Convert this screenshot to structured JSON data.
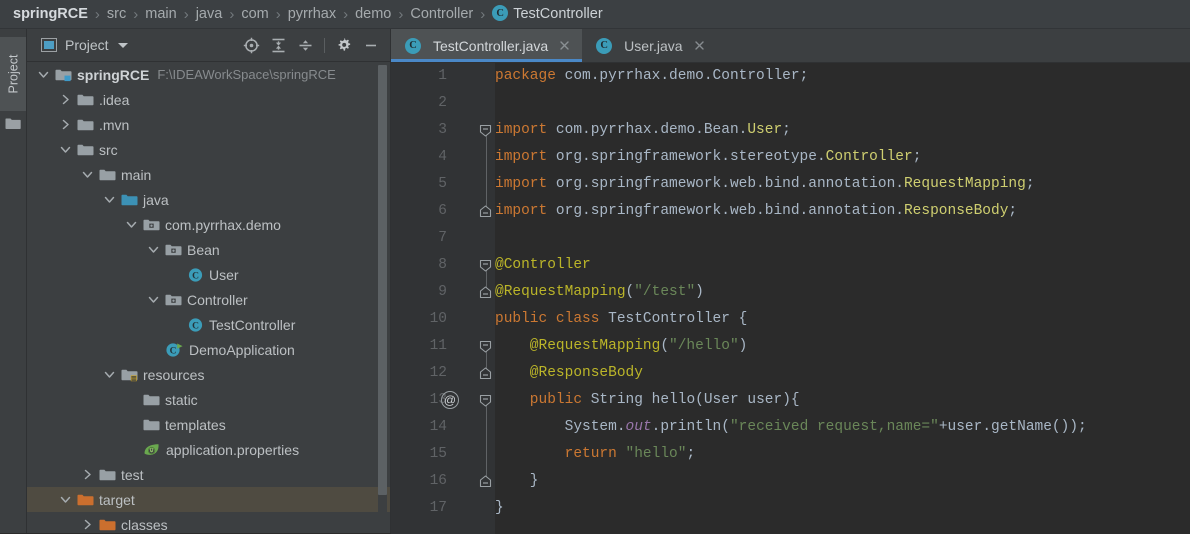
{
  "breadcrumb": {
    "items": [
      {
        "label": "springRCE",
        "type": "root"
      },
      {
        "label": "src",
        "type": "plain"
      },
      {
        "label": "main",
        "type": "plain"
      },
      {
        "label": "java",
        "type": "plain"
      },
      {
        "label": "com",
        "type": "plain"
      },
      {
        "label": "pyrrhax",
        "type": "plain"
      },
      {
        "label": "demo",
        "type": "plain"
      },
      {
        "label": "Controller",
        "type": "plain"
      },
      {
        "label": "TestController",
        "type": "class",
        "badge": "C"
      }
    ],
    "separator": "›"
  },
  "tool_strip": {
    "project_tab_label": "Project",
    "project_tab_icon": "folder-icon"
  },
  "project_panel": {
    "title": "Project",
    "title_icon": "project-window-icon",
    "dropdown_icon": "chevron-down-icon",
    "toolbar": [
      {
        "name": "select-opened-file-icon",
        "tooltip": "Select Opened File"
      },
      {
        "name": "expand-all-icon",
        "tooltip": "Expand All"
      },
      {
        "name": "collapse-all-icon",
        "tooltip": "Collapse All"
      },
      {
        "name": "settings-gear-icon",
        "tooltip": "Settings"
      },
      {
        "name": "hide-panel-icon",
        "tooltip": "Hide"
      }
    ],
    "tree": [
      {
        "label": "springRCE",
        "path": "F:\\IDEAWorkSpace\\springRCE",
        "indent": 0,
        "arrow": "down",
        "icon": "module-folder-icon",
        "bold": true,
        "selected": false
      },
      {
        "label": ".idea",
        "path": "",
        "indent": 1,
        "arrow": "right",
        "icon": "folder-icon",
        "bold": false,
        "selected": false
      },
      {
        "label": ".mvn",
        "path": "",
        "indent": 1,
        "arrow": "right",
        "icon": "folder-icon",
        "bold": false,
        "selected": false
      },
      {
        "label": "src",
        "path": "",
        "indent": 1,
        "arrow": "down",
        "icon": "folder-icon",
        "bold": false,
        "selected": false
      },
      {
        "label": "main",
        "path": "",
        "indent": 2,
        "arrow": "down",
        "icon": "folder-icon",
        "bold": false,
        "selected": false
      },
      {
        "label": "java",
        "path": "",
        "indent": 3,
        "arrow": "down",
        "icon": "source-root-folder-icon",
        "bold": false,
        "selected": false
      },
      {
        "label": "com.pyrrhax.demo",
        "path": "",
        "indent": 4,
        "arrow": "down",
        "icon": "package-icon",
        "bold": false,
        "selected": false
      },
      {
        "label": "Bean",
        "path": "",
        "indent": 5,
        "arrow": "down",
        "icon": "package-icon",
        "bold": false,
        "selected": false
      },
      {
        "label": "User",
        "path": "",
        "indent": 6,
        "arrow": "none",
        "icon": "java-class-icon",
        "bold": false,
        "selected": false
      },
      {
        "label": "Controller",
        "path": "",
        "indent": 5,
        "arrow": "down",
        "icon": "package-icon",
        "bold": false,
        "selected": false
      },
      {
        "label": "TestController",
        "path": "",
        "indent": 6,
        "arrow": "none",
        "icon": "java-class-icon",
        "bold": false,
        "selected": false
      },
      {
        "label": "DemoApplication",
        "path": "",
        "indent": 5,
        "arrow": "none",
        "icon": "runnable-class-icon",
        "bold": false,
        "selected": false
      },
      {
        "label": "resources",
        "path": "",
        "indent": 3,
        "arrow": "down",
        "icon": "resource-root-folder-icon",
        "bold": false,
        "selected": false
      },
      {
        "label": "static",
        "path": "",
        "indent": 4,
        "arrow": "none",
        "icon": "folder-icon",
        "bold": false,
        "selected": false
      },
      {
        "label": "templates",
        "path": "",
        "indent": 4,
        "arrow": "none",
        "icon": "folder-icon",
        "bold": false,
        "selected": false
      },
      {
        "label": "application.properties",
        "path": "",
        "indent": 4,
        "arrow": "none",
        "icon": "spring-properties-icon",
        "bold": false,
        "selected": false
      },
      {
        "label": "test",
        "path": "",
        "indent": 2,
        "arrow": "right",
        "icon": "folder-icon",
        "bold": false,
        "selected": false
      },
      {
        "label": "target",
        "path": "",
        "indent": 1,
        "arrow": "down",
        "icon": "excluded-folder-icon",
        "bold": false,
        "selected": true
      },
      {
        "label": "classes",
        "path": "",
        "indent": 2,
        "arrow": "right",
        "icon": "excluded-folder-icon",
        "bold": false,
        "selected": false
      }
    ]
  },
  "editor": {
    "tabs": [
      {
        "label": "TestController.java",
        "badge": "C",
        "active": true,
        "close_icon": "close-icon"
      },
      {
        "label": "User.java",
        "badge": "C",
        "active": false,
        "close_icon": "close-icon"
      }
    ],
    "line_numbers": [
      "1",
      "2",
      "3",
      "4",
      "5",
      "6",
      "7",
      "8",
      "9",
      "10",
      "11",
      "12",
      "13",
      "14",
      "15",
      "16",
      "17"
    ],
    "gutter_annotation": {
      "line": 13,
      "glyph": "@",
      "name": "annotation-gutter-icon"
    },
    "lines": [
      {
        "n": 1,
        "tokens": [
          {
            "t": "package ",
            "c": "kw"
          },
          {
            "t": "com.pyrrhax.demo.Controller;",
            "c": "id"
          }
        ]
      },
      {
        "n": 2,
        "tokens": []
      },
      {
        "n": 3,
        "tokens": [
          {
            "t": "import ",
            "c": "kw"
          },
          {
            "t": "com.pyrrhax.demo.Bean.",
            "c": "id"
          },
          {
            "t": "User",
            "c": "typ"
          },
          {
            "t": ";",
            "c": "id"
          }
        ]
      },
      {
        "n": 4,
        "tokens": [
          {
            "t": "import ",
            "c": "kw"
          },
          {
            "t": "org.springframework.stereotype.",
            "c": "id"
          },
          {
            "t": "Controller",
            "c": "typ"
          },
          {
            "t": ";",
            "c": "id"
          }
        ]
      },
      {
        "n": 5,
        "tokens": [
          {
            "t": "import ",
            "c": "kw"
          },
          {
            "t": "org.springframework.web.bind.annotation.",
            "c": "id"
          },
          {
            "t": "RequestMapping",
            "c": "typ"
          },
          {
            "t": ";",
            "c": "id"
          }
        ]
      },
      {
        "n": 6,
        "tokens": [
          {
            "t": "import ",
            "c": "kw"
          },
          {
            "t": "org.springframework.web.bind.annotation.",
            "c": "id"
          },
          {
            "t": "ResponseBody",
            "c": "typ"
          },
          {
            "t": ";",
            "c": "id"
          }
        ]
      },
      {
        "n": 7,
        "tokens": []
      },
      {
        "n": 8,
        "tokens": [
          {
            "t": "@Controller",
            "c": "ann"
          }
        ]
      },
      {
        "n": 9,
        "tokens": [
          {
            "t": "@RequestMapping",
            "c": "ann"
          },
          {
            "t": "(",
            "c": "pun"
          },
          {
            "t": "\"/test\"",
            "c": "str"
          },
          {
            "t": ")",
            "c": "pun"
          }
        ]
      },
      {
        "n": 10,
        "tokens": [
          {
            "t": "public class ",
            "c": "kw"
          },
          {
            "t": "TestController ",
            "c": "id"
          },
          {
            "t": "{",
            "c": "pun"
          }
        ]
      },
      {
        "n": 11,
        "tokens": [
          {
            "t": "    @RequestMapping",
            "c": "ann"
          },
          {
            "t": "(",
            "c": "pun"
          },
          {
            "t": "\"/hello\"",
            "c": "str"
          },
          {
            "t": ")",
            "c": "pun"
          }
        ]
      },
      {
        "n": 12,
        "tokens": [
          {
            "t": "    @ResponseBody",
            "c": "ann"
          }
        ]
      },
      {
        "n": 13,
        "tokens": [
          {
            "t": "    public ",
            "c": "kw"
          },
          {
            "t": "String ",
            "c": "id"
          },
          {
            "t": "hello",
            "c": "id"
          },
          {
            "t": "(",
            "c": "pun"
          },
          {
            "t": "User",
            "c": "id"
          },
          {
            "t": " user",
            "c": "id"
          },
          {
            "t": "){",
            "c": "pun"
          }
        ]
      },
      {
        "n": 14,
        "tokens": [
          {
            "t": "        System.",
            "c": "id"
          },
          {
            "t": "out",
            "c": "stat"
          },
          {
            "t": ".println(",
            "c": "id"
          },
          {
            "t": "\"received request,name=\"",
            "c": "str"
          },
          {
            "t": "+user.getName());",
            "c": "id"
          }
        ]
      },
      {
        "n": 15,
        "tokens": [
          {
            "t": "        return ",
            "c": "kw"
          },
          {
            "t": "\"hello\"",
            "c": "str"
          },
          {
            "t": ";",
            "c": "pun"
          }
        ]
      },
      {
        "n": 16,
        "tokens": [
          {
            "t": "    }",
            "c": "pun"
          }
        ]
      },
      {
        "n": 17,
        "tokens": [
          {
            "t": "}",
            "c": "pun"
          }
        ]
      }
    ],
    "fold_markers": [
      {
        "line": 3,
        "type": "open"
      },
      {
        "line": 6,
        "type": "close"
      },
      {
        "line": 8,
        "type": "open"
      },
      {
        "line": 9,
        "type": "close"
      },
      {
        "line": 11,
        "type": "open"
      },
      {
        "line": 12,
        "type": "close"
      },
      {
        "line": 13,
        "type": "open"
      },
      {
        "line": 16,
        "type": "close"
      }
    ]
  },
  "colors": {
    "editor_background": "#2b2b2b",
    "panel_background": "#3c3f41",
    "gutter_background": "#313335",
    "accent_blue": "#4a88c7",
    "selection_olive": "#4f4b41",
    "keyword_orange": "#cc7832",
    "string_green": "#6a8759",
    "annotation_yellow": "#bbb529",
    "type_yellow": "#cfcf70",
    "identifier_gray": "#a9b7c6",
    "static_purple": "#9876aa",
    "excluded_orange": "#cc7832"
  }
}
